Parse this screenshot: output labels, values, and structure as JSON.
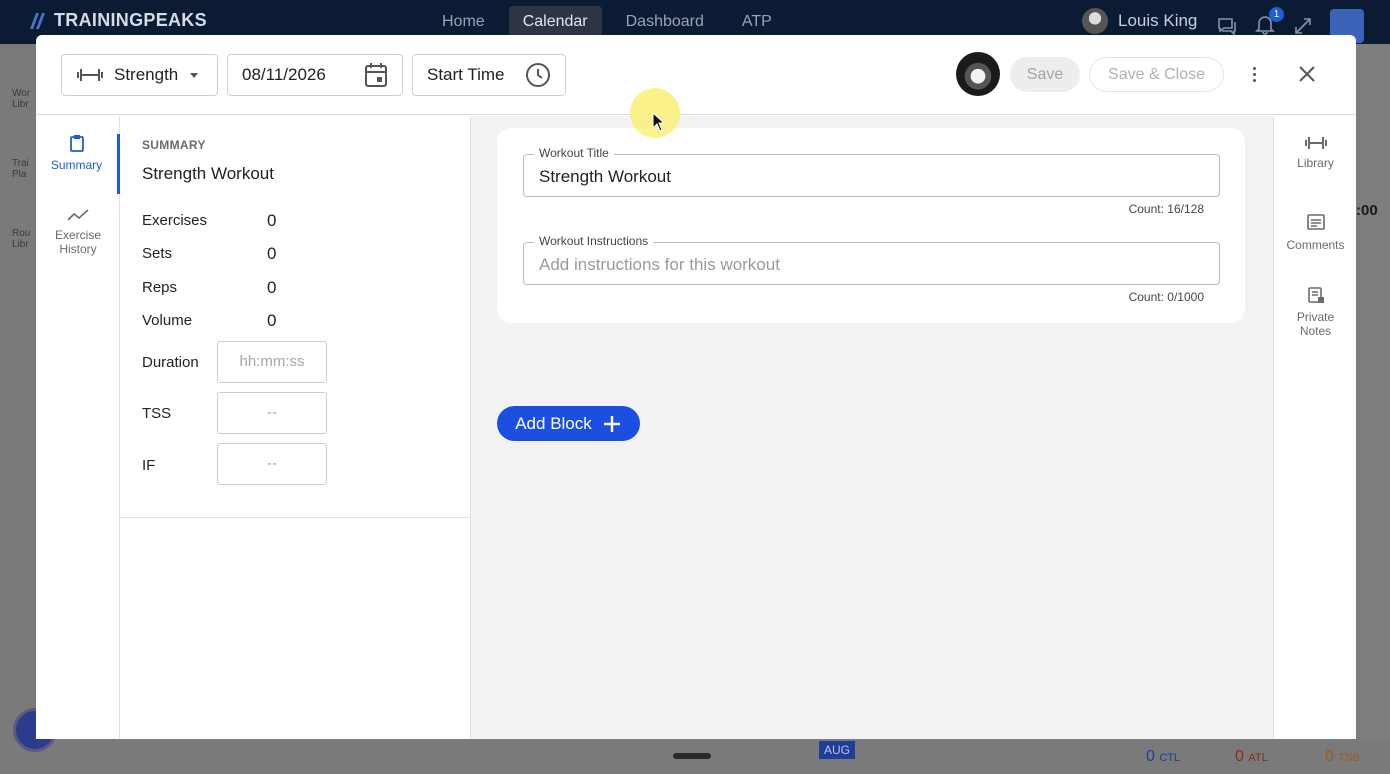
{
  "topnav": {
    "brand": "TRAININGPEAKS",
    "tabs": [
      {
        "label": "Home"
      },
      {
        "label": "Calendar"
      },
      {
        "label": "Dashboard"
      },
      {
        "label": "ATP"
      }
    ],
    "active_tab": "Calendar",
    "user_name": "Louis King",
    "notification_count": "1"
  },
  "background": {
    "left_labels": [
      "Wor Libr",
      "Trai Pla",
      "Rou Libr"
    ],
    "right_stat": ":00",
    "bottom": {
      "month_badge": "AUG",
      "ctl": "0",
      "ctl_label": "CTL",
      "atl": "0",
      "atl_label": "ATL",
      "tsb": "0",
      "tsb_label": "TSB"
    }
  },
  "header": {
    "workout_type": "Strength",
    "date": "08/11/2026",
    "start_time_label": "Start Time",
    "save_label": "Save",
    "save_close_label": "Save & Close"
  },
  "left_rail": {
    "summary_label": "Summary",
    "exercise_history_label": "Exercise History"
  },
  "summary": {
    "section_label": "SUMMARY",
    "title": "Strength Workout",
    "stats": [
      {
        "label": "Exercises",
        "value": "0"
      },
      {
        "label": "Sets",
        "value": "0"
      },
      {
        "label": "Reps",
        "value": "0"
      },
      {
        "label": "Volume",
        "value": "0"
      }
    ],
    "duration_label": "Duration",
    "duration_placeholder": "hh:mm:ss",
    "tss_label": "TSS",
    "tss_value": "--",
    "if_label": "IF",
    "if_value": "--"
  },
  "main": {
    "title_field_label": "Workout Title",
    "title_value": "Strength Workout",
    "title_count": "Count: 16/128",
    "instructions_label": "Workout Instructions",
    "instructions_placeholder": "Add instructions for this workout",
    "instructions_count": "Count: 0/1000",
    "add_block_label": "Add Block"
  },
  "right_rail": {
    "library_label": "Library",
    "comments_label": "Comments",
    "private_notes_label": "Private Notes"
  },
  "colors": {
    "accent": "#1c4fe0",
    "nav_bg": "#0b1b33"
  }
}
